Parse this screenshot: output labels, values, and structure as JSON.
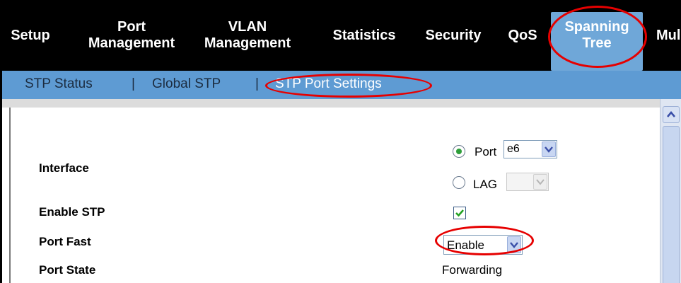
{
  "nav": {
    "items": [
      {
        "lines": [
          "Setup"
        ]
      },
      {
        "lines": [
          "Port",
          "Management"
        ]
      },
      {
        "lines": [
          "VLAN",
          "Management"
        ]
      },
      {
        "lines": [
          "Statistics"
        ]
      },
      {
        "lines": [
          "Security"
        ]
      },
      {
        "lines": [
          "QoS"
        ]
      },
      {
        "lines": [
          "Spanning",
          "Tree"
        ]
      },
      {
        "lines": [
          "Mul"
        ]
      }
    ],
    "active_color": "#6fa7d8"
  },
  "subnav": {
    "items": [
      "STP Status",
      "Global STP",
      "STP Port Settings"
    ],
    "separator": "|",
    "active_index": 2
  },
  "form": {
    "interface_label": "Interface",
    "port_option": "Port",
    "port_value": "e6",
    "lag_option": "LAG",
    "lag_value": "",
    "selected_interface": "Port",
    "enable_stp_label": "Enable STP",
    "enable_stp_checked": true,
    "port_fast_label": "Port Fast",
    "port_fast_value": "Enable",
    "port_state_label": "Port State",
    "port_state_value": "Forwarding"
  },
  "colors": {
    "highlight": "#e60000",
    "subnav_bg": "#5e9bd3",
    "nav_bg": "#000000"
  }
}
